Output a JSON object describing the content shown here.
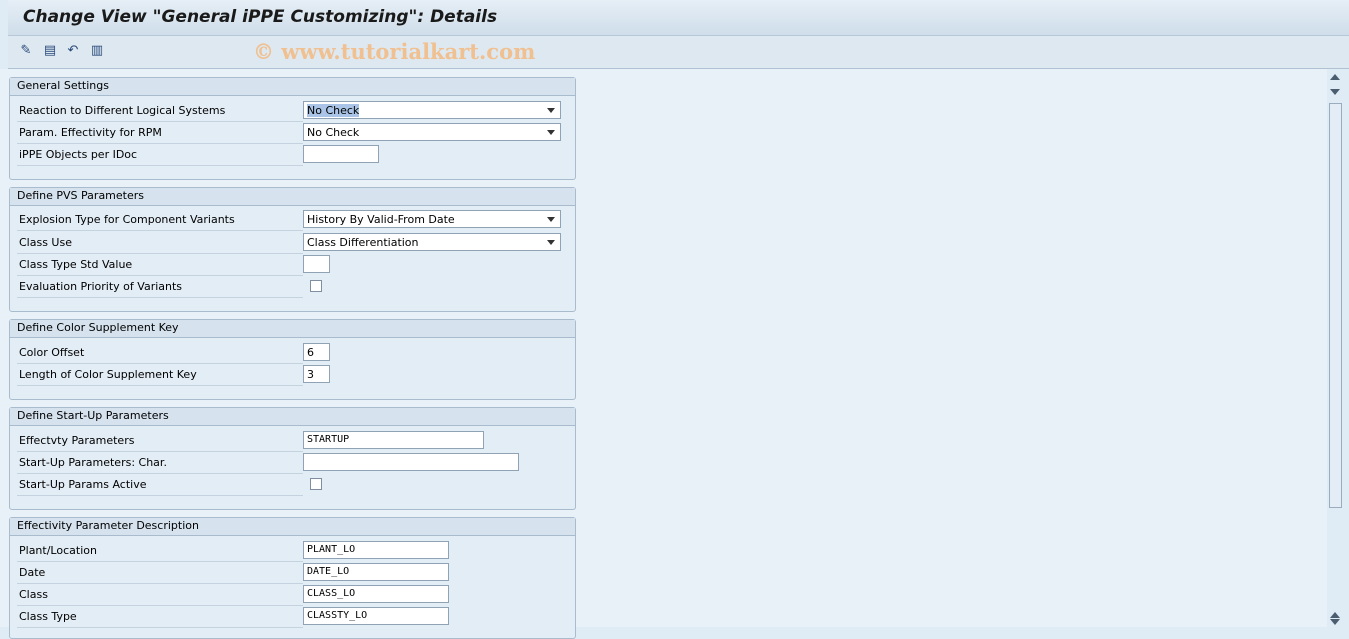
{
  "title": "Change View \"General iPPE Customizing\": Details",
  "watermark": "© www.tutorialkart.com",
  "toolbar": {
    "icons": [
      "display-change-icon",
      "save-icon",
      "undo-icon",
      "transport-icon"
    ]
  },
  "groups": [
    {
      "title": "General Settings",
      "rows": [
        {
          "label": "Reaction to Different Logical Systems",
          "value": "No Check",
          "type": "dropdown"
        },
        {
          "label": "Param. Effectivity for RPM",
          "value": "No Check",
          "type": "dropdown"
        },
        {
          "label": "iPPE Objects per IDoc",
          "value": "",
          "type": "input"
        }
      ]
    },
    {
      "title": "Define PVS Parameters",
      "rows": [
        {
          "label": "Explosion Type for Component Variants",
          "value": "History By Valid-From Date",
          "type": "dropdown"
        },
        {
          "label": "Class Use",
          "value": "Class Differentiation",
          "type": "dropdown"
        },
        {
          "label": "Class Type Std Value",
          "value": "",
          "type": "input"
        },
        {
          "label": "Evaluation Priority of Variants",
          "checked": false,
          "type": "checkbox"
        }
      ]
    },
    {
      "title": "Define Color Supplement Key",
      "rows": [
        {
          "label": "Color Offset",
          "value": "6",
          "type": "input"
        },
        {
          "label": "Length of Color Supplement Key",
          "value": "3",
          "type": "input"
        }
      ]
    },
    {
      "title": "Define Start-Up Parameters",
      "rows": [
        {
          "label": "Effectvty Parameters",
          "value": "STARTUP",
          "type": "input"
        },
        {
          "label": "Start-Up Parameters: Char.",
          "value": "",
          "type": "input"
        },
        {
          "label": "Start-Up Params Active",
          "checked": false,
          "type": "checkbox"
        }
      ]
    },
    {
      "title": "Effectivity Parameter Description",
      "rows": [
        {
          "label": "Plant/Location",
          "value": "PLANT_LO",
          "type": "input"
        },
        {
          "label": "Date",
          "value": "DATE_LO",
          "type": "input"
        },
        {
          "label": "Class",
          "value": "CLASS_LO",
          "type": "input"
        },
        {
          "label": "Class Type",
          "value": "CLASSTY_LO",
          "type": "input"
        }
      ]
    }
  ]
}
